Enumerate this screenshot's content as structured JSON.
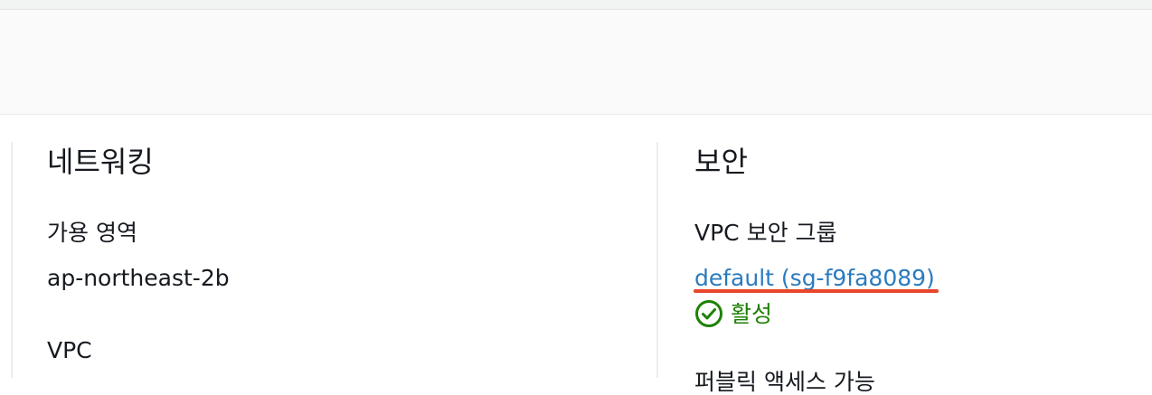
{
  "networking": {
    "title": "네트워킹",
    "availability_zone_label": "가용 영역",
    "availability_zone_value": "ap-northeast-2b",
    "vpc_label": "VPC"
  },
  "security": {
    "title": "보안",
    "vpc_sg_label": "VPC 보안 그룹",
    "sg_link": "default (sg-f9fa8089)",
    "sg_status": "활성",
    "next_label_partial": "퍼블릭 액세스 가능"
  },
  "colors": {
    "link": "#2a7bbf",
    "status_active": "#1d8102",
    "highlight_underline": "#e8462b"
  }
}
